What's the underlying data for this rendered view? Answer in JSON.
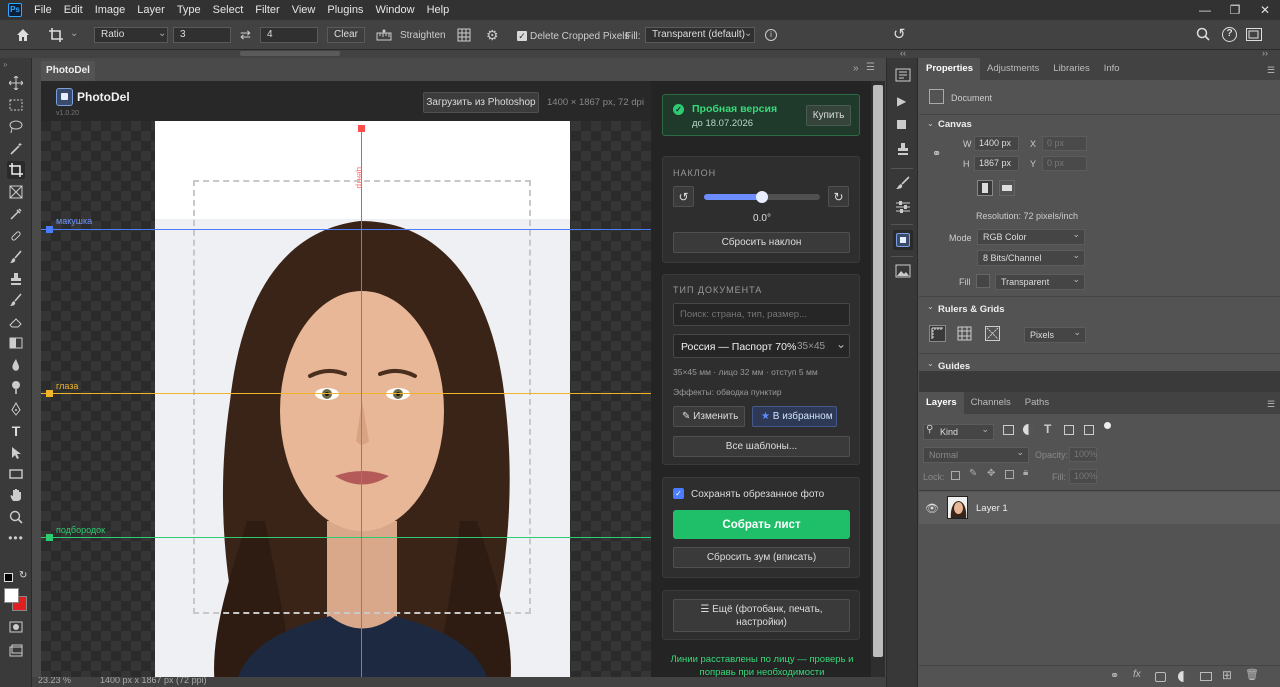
{
  "menu": {
    "logo": "Ps",
    "items": [
      "File",
      "Edit",
      "Image",
      "Layer",
      "Type",
      "Select",
      "Filter",
      "View",
      "Plugins",
      "Window",
      "Help"
    ]
  },
  "options": {
    "ratio_label": "Ratio",
    "width_value": "3",
    "height_value": "4",
    "clear_label": "Clear",
    "straighten_label": "Straighten",
    "delete_cropped_label": "Delete Cropped Pixels",
    "fill_label": "Fill:",
    "fill_value": "Transparent (default)"
  },
  "document": {
    "tab_title": "PhotoDel"
  },
  "plugin": {
    "name": "PhotoDel",
    "version": "v1.0.20",
    "load_button": "Загрузить из Photoshop",
    "image_info": "1400 × 1867 px, 72 dpi",
    "guides": {
      "crown": "макушка",
      "eyes": "глаза",
      "chin": "подбородок",
      "center": "центр"
    },
    "trial": {
      "title": "Пробная версия",
      "until": "до 18.07.2026",
      "buy": "Купить"
    },
    "tilt": {
      "title": "НАКЛОН",
      "value": "0.0°",
      "reset": "Сбросить наклон",
      "level": 0.5
    },
    "doctype": {
      "title": "ТИП ДОКУМЕНТА",
      "search_placeholder": "Поиск: страна, тип, размер...",
      "selected": "Россия — Паспорт 70%",
      "selected_size": "35×45",
      "specs": "35×45 мм · лицо 32 мм · отступ 5 мм",
      "effects": "Эффекты: обводка пунктир",
      "edit": "Изменить",
      "favorite": "В избранном",
      "all_templates": "Все шаблоны..."
    },
    "keep_cropped": "Сохранять обрезанное фото",
    "assemble": "Собрать лист",
    "reset_zoom": "Сбросить зум (вписать)",
    "more": "Ещё (фотобанк, печать, настройки)",
    "hint": "Линии расставлены по лицу — проверь и поправь при необходимости"
  },
  "status": {
    "zoom": "23.23 %",
    "info": "1400 px x 1867 px (72 ppi)"
  },
  "properties": {
    "tabs": [
      "Properties",
      "Adjustments",
      "Libraries",
      "Info"
    ],
    "document_label": "Document",
    "canvas_title": "Canvas",
    "w_label": "W",
    "w_value": "1400 px",
    "h_label": "H",
    "h_value": "1867 px",
    "x_label": "X",
    "x_value": "0 px",
    "y_label": "Y",
    "y_value": "0 px",
    "resolution": "Resolution: 72 pixels/inch",
    "mode_label": "Mode",
    "mode_value": "RGB Color",
    "bits_value": "8 Bits/Channel",
    "fill_label": "Fill",
    "fill_value": "Transparent",
    "rulers_title": "Rulers & Grids",
    "units_value": "Pixels",
    "guides_title": "Guides"
  },
  "layers": {
    "tabs": [
      "Layers",
      "Channels",
      "Paths"
    ],
    "kind": "Kind",
    "blend": "Normal",
    "opacity_label": "Opacity:",
    "opacity_value": "100%",
    "lock_label": "Lock:",
    "fill_label": "Fill:",
    "fill_value": "100%",
    "layer_name": "Layer 1"
  },
  "colors": {
    "accent_green": "#1fbf6a",
    "guide_blue": "#4a7dff",
    "guide_yellow": "#f0b429",
    "guide_green": "#2ecc71",
    "guide_red": "#ff4d4d"
  }
}
